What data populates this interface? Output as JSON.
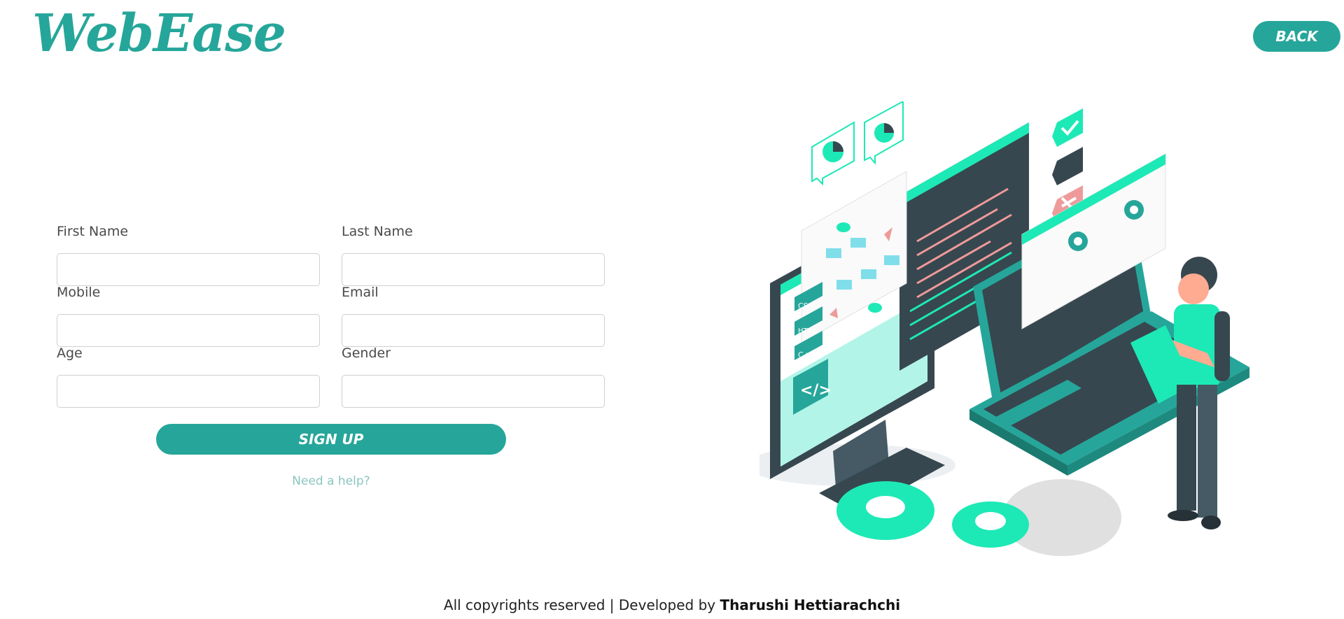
{
  "header": {
    "logo": "WebEase",
    "back_label": "BACK"
  },
  "form": {
    "fields": [
      {
        "label": "First Name",
        "value": "",
        "placeholder": ""
      },
      {
        "label": "Last Name",
        "value": "",
        "placeholder": ""
      },
      {
        "label": "Mobile",
        "value": "",
        "placeholder": ""
      },
      {
        "label": "Email",
        "value": "",
        "placeholder": ""
      },
      {
        "label": "Age",
        "value": "",
        "placeholder": ""
      },
      {
        "label": "Gender",
        "value": "",
        "placeholder": ""
      }
    ],
    "submit_label": "SIGN UP",
    "help_label": "Need a help?"
  },
  "illustration": {
    "icon": "developer-workspace-illustration",
    "labels": [
      "CSS",
      "HTML",
      "C++"
    ]
  },
  "footer": {
    "text": "All copyrights reserved | Developed by ",
    "author": "Tharushi Hettiarachchi"
  },
  "colors": {
    "accent": "#26a69a",
    "help": "#8ac6bf",
    "illustration_teal": "#1de9b6",
    "illustration_dark": "#37474f"
  }
}
